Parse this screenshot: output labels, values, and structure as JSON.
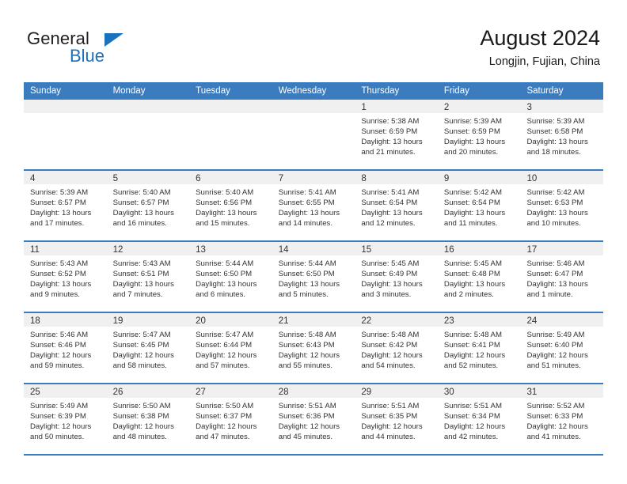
{
  "brand": {
    "name_top": "General",
    "name_bottom": "Blue",
    "triangle_icon": "triangle-icon",
    "accent_color": "#1a72bd"
  },
  "header": {
    "title": "August 2024",
    "subtitle": "Longjin, Fujian, China"
  },
  "calendar": {
    "header_bg": "#3b7cbf",
    "weekdays": [
      "Sunday",
      "Monday",
      "Tuesday",
      "Wednesday",
      "Thursday",
      "Friday",
      "Saturday"
    ],
    "weeks": [
      [
        {
          "day": "",
          "sunrise": "",
          "sunset": "",
          "daylight_line1": "",
          "daylight_line2": ""
        },
        {
          "day": "",
          "sunrise": "",
          "sunset": "",
          "daylight_line1": "",
          "daylight_line2": ""
        },
        {
          "day": "",
          "sunrise": "",
          "sunset": "",
          "daylight_line1": "",
          "daylight_line2": ""
        },
        {
          "day": "",
          "sunrise": "",
          "sunset": "",
          "daylight_line1": "",
          "daylight_line2": ""
        },
        {
          "day": "1",
          "sunrise": "Sunrise: 5:38 AM",
          "sunset": "Sunset: 6:59 PM",
          "daylight_line1": "Daylight: 13 hours",
          "daylight_line2": "and 21 minutes."
        },
        {
          "day": "2",
          "sunrise": "Sunrise: 5:39 AM",
          "sunset": "Sunset: 6:59 PM",
          "daylight_line1": "Daylight: 13 hours",
          "daylight_line2": "and 20 minutes."
        },
        {
          "day": "3",
          "sunrise": "Sunrise: 5:39 AM",
          "sunset": "Sunset: 6:58 PM",
          "daylight_line1": "Daylight: 13 hours",
          "daylight_line2": "and 18 minutes."
        }
      ],
      [
        {
          "day": "4",
          "sunrise": "Sunrise: 5:39 AM",
          "sunset": "Sunset: 6:57 PM",
          "daylight_line1": "Daylight: 13 hours",
          "daylight_line2": "and 17 minutes."
        },
        {
          "day": "5",
          "sunrise": "Sunrise: 5:40 AM",
          "sunset": "Sunset: 6:57 PM",
          "daylight_line1": "Daylight: 13 hours",
          "daylight_line2": "and 16 minutes."
        },
        {
          "day": "6",
          "sunrise": "Sunrise: 5:40 AM",
          "sunset": "Sunset: 6:56 PM",
          "daylight_line1": "Daylight: 13 hours",
          "daylight_line2": "and 15 minutes."
        },
        {
          "day": "7",
          "sunrise": "Sunrise: 5:41 AM",
          "sunset": "Sunset: 6:55 PM",
          "daylight_line1": "Daylight: 13 hours",
          "daylight_line2": "and 14 minutes."
        },
        {
          "day": "8",
          "sunrise": "Sunrise: 5:41 AM",
          "sunset": "Sunset: 6:54 PM",
          "daylight_line1": "Daylight: 13 hours",
          "daylight_line2": "and 12 minutes."
        },
        {
          "day": "9",
          "sunrise": "Sunrise: 5:42 AM",
          "sunset": "Sunset: 6:54 PM",
          "daylight_line1": "Daylight: 13 hours",
          "daylight_line2": "and 11 minutes."
        },
        {
          "day": "10",
          "sunrise": "Sunrise: 5:42 AM",
          "sunset": "Sunset: 6:53 PM",
          "daylight_line1": "Daylight: 13 hours",
          "daylight_line2": "and 10 minutes."
        }
      ],
      [
        {
          "day": "11",
          "sunrise": "Sunrise: 5:43 AM",
          "sunset": "Sunset: 6:52 PM",
          "daylight_line1": "Daylight: 13 hours",
          "daylight_line2": "and 9 minutes."
        },
        {
          "day": "12",
          "sunrise": "Sunrise: 5:43 AM",
          "sunset": "Sunset: 6:51 PM",
          "daylight_line1": "Daylight: 13 hours",
          "daylight_line2": "and 7 minutes."
        },
        {
          "day": "13",
          "sunrise": "Sunrise: 5:44 AM",
          "sunset": "Sunset: 6:50 PM",
          "daylight_line1": "Daylight: 13 hours",
          "daylight_line2": "and 6 minutes."
        },
        {
          "day": "14",
          "sunrise": "Sunrise: 5:44 AM",
          "sunset": "Sunset: 6:50 PM",
          "daylight_line1": "Daylight: 13 hours",
          "daylight_line2": "and 5 minutes."
        },
        {
          "day": "15",
          "sunrise": "Sunrise: 5:45 AM",
          "sunset": "Sunset: 6:49 PM",
          "daylight_line1": "Daylight: 13 hours",
          "daylight_line2": "and 3 minutes."
        },
        {
          "day": "16",
          "sunrise": "Sunrise: 5:45 AM",
          "sunset": "Sunset: 6:48 PM",
          "daylight_line1": "Daylight: 13 hours",
          "daylight_line2": "and 2 minutes."
        },
        {
          "day": "17",
          "sunrise": "Sunrise: 5:46 AM",
          "sunset": "Sunset: 6:47 PM",
          "daylight_line1": "Daylight: 13 hours",
          "daylight_line2": "and 1 minute."
        }
      ],
      [
        {
          "day": "18",
          "sunrise": "Sunrise: 5:46 AM",
          "sunset": "Sunset: 6:46 PM",
          "daylight_line1": "Daylight: 12 hours",
          "daylight_line2": "and 59 minutes."
        },
        {
          "day": "19",
          "sunrise": "Sunrise: 5:47 AM",
          "sunset": "Sunset: 6:45 PM",
          "daylight_line1": "Daylight: 12 hours",
          "daylight_line2": "and 58 minutes."
        },
        {
          "day": "20",
          "sunrise": "Sunrise: 5:47 AM",
          "sunset": "Sunset: 6:44 PM",
          "daylight_line1": "Daylight: 12 hours",
          "daylight_line2": "and 57 minutes."
        },
        {
          "day": "21",
          "sunrise": "Sunrise: 5:48 AM",
          "sunset": "Sunset: 6:43 PM",
          "daylight_line1": "Daylight: 12 hours",
          "daylight_line2": "and 55 minutes."
        },
        {
          "day": "22",
          "sunrise": "Sunrise: 5:48 AM",
          "sunset": "Sunset: 6:42 PM",
          "daylight_line1": "Daylight: 12 hours",
          "daylight_line2": "and 54 minutes."
        },
        {
          "day": "23",
          "sunrise": "Sunrise: 5:48 AM",
          "sunset": "Sunset: 6:41 PM",
          "daylight_line1": "Daylight: 12 hours",
          "daylight_line2": "and 52 minutes."
        },
        {
          "day": "24",
          "sunrise": "Sunrise: 5:49 AM",
          "sunset": "Sunset: 6:40 PM",
          "daylight_line1": "Daylight: 12 hours",
          "daylight_line2": "and 51 minutes."
        }
      ],
      [
        {
          "day": "25",
          "sunrise": "Sunrise: 5:49 AM",
          "sunset": "Sunset: 6:39 PM",
          "daylight_line1": "Daylight: 12 hours",
          "daylight_line2": "and 50 minutes."
        },
        {
          "day": "26",
          "sunrise": "Sunrise: 5:50 AM",
          "sunset": "Sunset: 6:38 PM",
          "daylight_line1": "Daylight: 12 hours",
          "daylight_line2": "and 48 minutes."
        },
        {
          "day": "27",
          "sunrise": "Sunrise: 5:50 AM",
          "sunset": "Sunset: 6:37 PM",
          "daylight_line1": "Daylight: 12 hours",
          "daylight_line2": "and 47 minutes."
        },
        {
          "day": "28",
          "sunrise": "Sunrise: 5:51 AM",
          "sunset": "Sunset: 6:36 PM",
          "daylight_line1": "Daylight: 12 hours",
          "daylight_line2": "and 45 minutes."
        },
        {
          "day": "29",
          "sunrise": "Sunrise: 5:51 AM",
          "sunset": "Sunset: 6:35 PM",
          "daylight_line1": "Daylight: 12 hours",
          "daylight_line2": "and 44 minutes."
        },
        {
          "day": "30",
          "sunrise": "Sunrise: 5:51 AM",
          "sunset": "Sunset: 6:34 PM",
          "daylight_line1": "Daylight: 12 hours",
          "daylight_line2": "and 42 minutes."
        },
        {
          "day": "31",
          "sunrise": "Sunrise: 5:52 AM",
          "sunset": "Sunset: 6:33 PM",
          "daylight_line1": "Daylight: 12 hours",
          "daylight_line2": "and 41 minutes."
        }
      ]
    ]
  }
}
